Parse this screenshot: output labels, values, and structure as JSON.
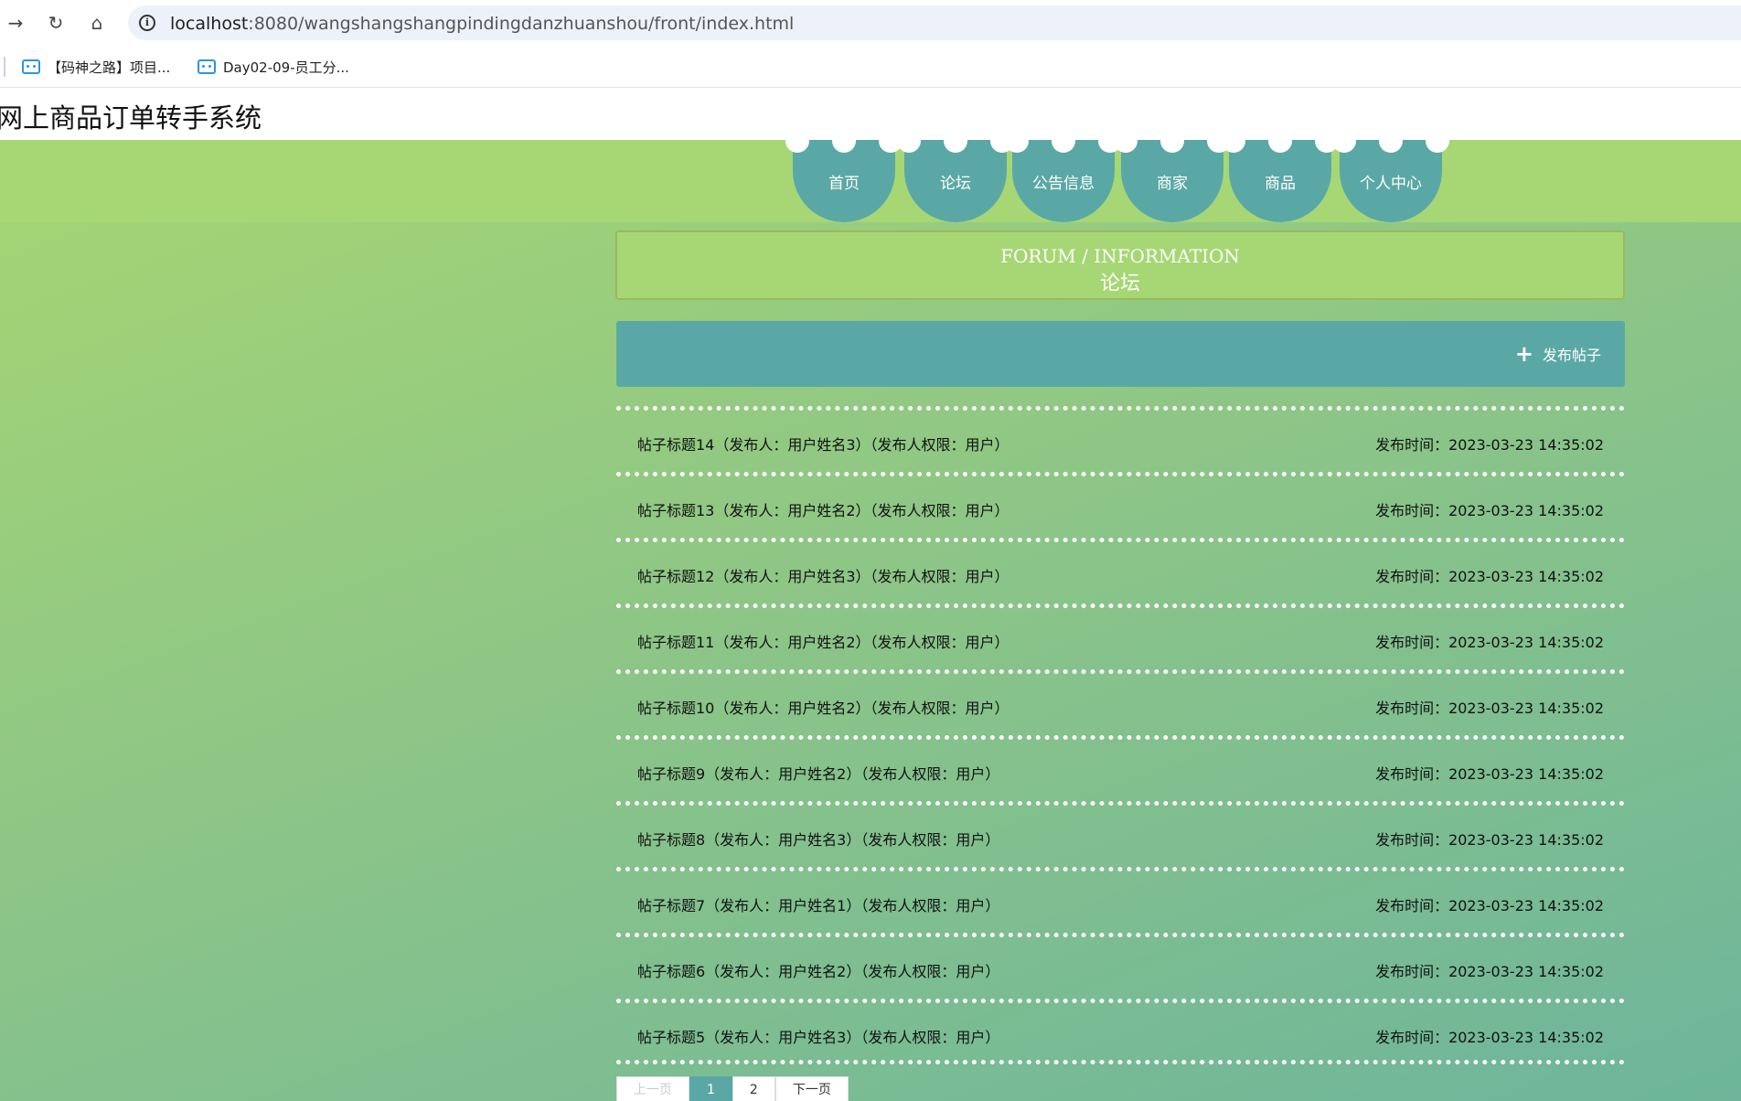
{
  "browser": {
    "url_host": "localhost",
    "url_rest": ":8080/wangshangshangpindingdanzhuanshou/front/index.html",
    "bookmarks": [
      {
        "label": "【码神之路】项目..."
      },
      {
        "label": "Day02-09-员工分..."
      }
    ]
  },
  "site": {
    "title": "网上商品订单转手系统"
  },
  "nav": {
    "tabs": [
      {
        "label": "首页"
      },
      {
        "label": "论坛"
      },
      {
        "label": "公告信息"
      },
      {
        "label": "商家"
      },
      {
        "label": "商品"
      },
      {
        "label": "个人中心"
      }
    ]
  },
  "section": {
    "title_en": "FORUM / INFORMATION",
    "title_cn": "论坛"
  },
  "toolbar": {
    "publish_label": "发布帖子",
    "publish_icon": "plus-icon"
  },
  "posts": [
    {
      "title": "帖子标题14（发布人：用户姓名3）（发布人权限：用户）",
      "time": "发布时间：2023-03-23 14:35:02"
    },
    {
      "title": "帖子标题13（发布人：用户姓名2）（发布人权限：用户）",
      "time": "发布时间：2023-03-23 14:35:02"
    },
    {
      "title": "帖子标题12（发布人：用户姓名3）（发布人权限：用户）",
      "time": "发布时间：2023-03-23 14:35:02"
    },
    {
      "title": "帖子标题11（发布人：用户姓名2）（发布人权限：用户）",
      "time": "发布时间：2023-03-23 14:35:02"
    },
    {
      "title": "帖子标题10（发布人：用户姓名2）（发布人权限：用户）",
      "time": "发布时间：2023-03-23 14:35:02"
    },
    {
      "title": "帖子标题9（发布人：用户姓名2）（发布人权限：用户）",
      "time": "发布时间：2023-03-23 14:35:02"
    },
    {
      "title": "帖子标题8（发布人：用户姓名3）（发布人权限：用户）",
      "time": "发布时间：2023-03-23 14:35:02"
    },
    {
      "title": "帖子标题7（发布人：用户姓名1）（发布人权限：用户）",
      "time": "发布时间：2023-03-23 14:35:02"
    },
    {
      "title": "帖子标题6（发布人：用户姓名2）（发布人权限：用户）",
      "time": "发布时间：2023-03-23 14:35:02"
    },
    {
      "title": "帖子标题5（发布人：用户姓名3）（发布人权限：用户）",
      "time": "发布时间：2023-03-23 14:35:02"
    }
  ],
  "pager": {
    "prev": "上一页",
    "pages": [
      "1",
      "2"
    ],
    "current": "1",
    "next": "下一页"
  },
  "colors": {
    "accent": "#5aa8a5",
    "band": "#a6d774"
  }
}
